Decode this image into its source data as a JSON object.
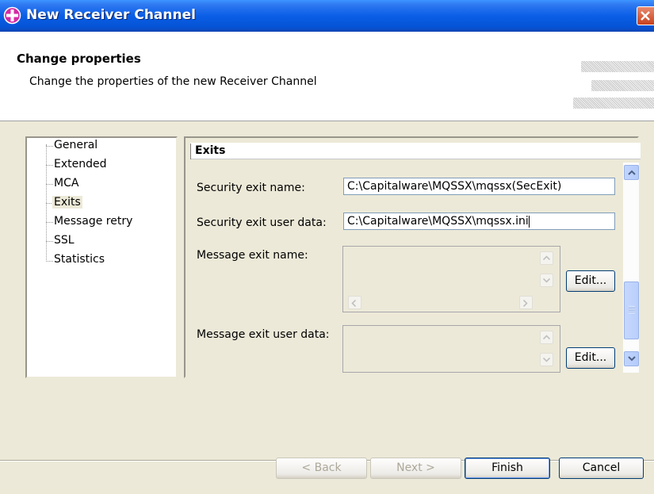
{
  "window": {
    "title": "New Receiver Channel"
  },
  "header": {
    "title": "Change properties",
    "description": "Change the properties of the new Receiver Channel"
  },
  "tree": {
    "items": [
      {
        "label": "General"
      },
      {
        "label": "Extended"
      },
      {
        "label": "MCA"
      },
      {
        "label": "Exits"
      },
      {
        "label": "Message retry"
      },
      {
        "label": "SSL"
      },
      {
        "label": "Statistics"
      }
    ],
    "selected": "Exits"
  },
  "exits": {
    "section_title": "Exits",
    "security_exit_name": {
      "label": "Security exit name:",
      "value": "C:\\Capitalware\\MQSSX\\mqssx(SecExit)"
    },
    "security_exit_user_data": {
      "label": "Security exit user data:",
      "value": "C:\\Capitalware\\MQSSX\\mqssx.ini"
    },
    "message_exit_name": {
      "label": "Message exit name:",
      "edit_label": "Edit..."
    },
    "message_exit_user_data": {
      "label": "Message exit user data:",
      "edit_label": "Edit..."
    }
  },
  "footer": {
    "back": "< Back",
    "next": "Next >",
    "finish": "Finish",
    "cancel": "Cancel"
  },
  "colors": {
    "titlebar": "#0a5ee6",
    "dialog_bg": "#ece9d8",
    "close_button": "#c9421d",
    "scrollbar": "#c1d5fd"
  }
}
